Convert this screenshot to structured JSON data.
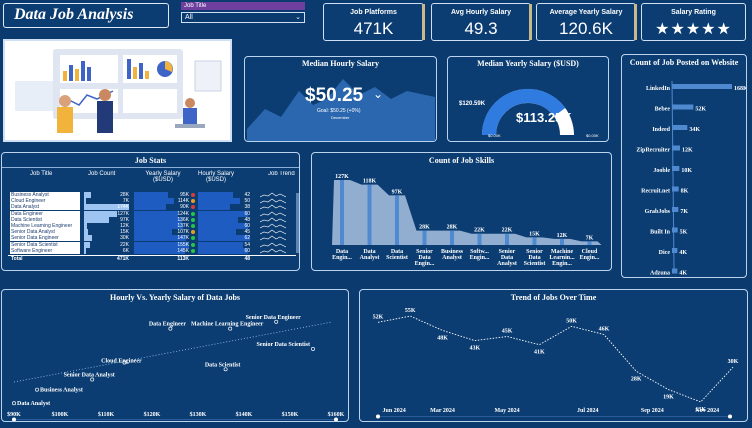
{
  "title": "Data Job Analysis",
  "filter": {
    "label": "Job Title",
    "value": "All"
  },
  "kpis": [
    {
      "label": "Job Platforms",
      "value": "471K"
    },
    {
      "label": "Avg Hourly Salary",
      "value": "49.3"
    },
    {
      "label": "Average Yearly Salary",
      "value": "120.6K"
    },
    {
      "label": "Salary Rating",
      "value": "★★★★★"
    }
  ],
  "median_hourly": {
    "title": "Median Hourly Salary",
    "value": "$50.25",
    "goal": "Goal: $50.25 (+0%)",
    "month": "December"
  },
  "median_yearly": {
    "title": "Median Yearly Salary ($USD)",
    "value": "$113.25K",
    "min": "$120.59K",
    "low": "$0.00K",
    "high": "$0.00K",
    "fill": 0.8
  },
  "job_stats": {
    "title": "Job Stats",
    "headers": [
      "Job Title",
      "Job Count",
      "Yearly Salary ($USD)",
      "Hourly Salary ($USD)",
      "Job Trend"
    ],
    "titles": [
      "Business Analyst",
      "Cloud Engineer",
      "Data Analyst",
      "Data Engineer",
      "Data Scientist",
      "Machine Learning Engineer",
      "Senior Data Analyst",
      "Senior Data Engineer",
      "Senior Data Scientist",
      "Software Engineer"
    ],
    "counts": [
      "28K",
      "7K",
      "174K",
      "127K",
      "97K",
      "12K",
      "15K",
      "30K",
      "22K",
      "6K"
    ],
    "yearly": [
      "95K",
      "114K",
      "90K",
      "124K",
      "136K",
      "137K",
      "107K",
      "147K",
      "155K",
      "145K"
    ],
    "hourly": [
      "42",
      "50",
      "38",
      "60",
      "48",
      "60",
      "45",
      "62",
      "54",
      "60"
    ],
    "total": {
      "label": "Total",
      "count": "471K",
      "yearly": "113K",
      "hourly": "48"
    }
  },
  "skills": {
    "title": "Count of Job Skills",
    "labels": [
      "Data Engin...",
      "Data Analyst",
      "Data Scientist",
      "Senior Data Engin...",
      "Business Analyst",
      "Softw... Engin...",
      "Senior Data Analyst",
      "Senior Data Scientist",
      "Machine Learnin... Engin...",
      "Cloud Engin..."
    ],
    "value_labels": [
      "127K",
      "118K",
      "97K",
      "28K",
      "28K",
      "22K",
      "22K",
      "15K",
      "12K",
      "7K"
    ]
  },
  "chart_data": [
    {
      "type": "bar",
      "title": "Count of Job Posted on Website",
      "categories": [
        "LinkedIn",
        "Bebee",
        "Indeed",
        "ZipRecruiter",
        "Jooble",
        "Recruit.net",
        "GrabJobs",
        "Built In",
        "Dice",
        "Adzuna"
      ],
      "values": [
        168,
        52,
        34,
        12,
        10,
        8,
        7,
        5,
        4,
        4
      ],
      "value_labels": [
        "168K",
        "52K",
        "34K",
        "12K",
        "10K",
        "8K",
        "7K",
        "5K",
        "4K",
        "4K"
      ]
    },
    {
      "type": "scatter",
      "title": "Hourly Vs. Yearly Salary of Data Jobs",
      "x_ticks": [
        "$90K",
        "$100K",
        "$110K",
        "$120K",
        "$130K",
        "$140K",
        "$150K",
        "$160K"
      ],
      "xlim": [
        90,
        160
      ],
      "points": [
        {
          "label": "Data Analyst",
          "x": 90,
          "y": 38
        },
        {
          "label": "Business Analyst",
          "x": 95,
          "y": 42
        },
        {
          "label": "Senior Data Analyst",
          "x": 107,
          "y": 45
        },
        {
          "label": "Cloud Engineer",
          "x": 114,
          "y": 50
        },
        {
          "label": "Data Scientist",
          "x": 136,
          "y": 48
        },
        {
          "label": "Data Engineer",
          "x": 124,
          "y": 60
        },
        {
          "label": "Machine Learning Engineer",
          "x": 137,
          "y": 60
        },
        {
          "label": "Senior Data Engineer",
          "x": 147,
          "y": 62
        },
        {
          "label": "Senior Data Scientist",
          "x": 155,
          "y": 54
        }
      ]
    },
    {
      "type": "line",
      "title": "Trend of Jobs Over Time",
      "x_ticks": [
        "Jun 2024",
        "Mar 2024",
        "May 2024",
        "Jul 2024",
        "Sep 2024",
        "Nov 2024"
      ],
      "values": [
        52,
        55,
        48,
        43,
        45,
        41,
        50,
        46,
        28,
        19,
        13,
        30
      ],
      "value_labels": [
        "52K",
        "55K",
        "48K",
        "43K",
        "45K",
        "41K",
        "50K",
        "46K",
        "28K",
        "19K",
        "13K",
        "30K"
      ]
    }
  ]
}
